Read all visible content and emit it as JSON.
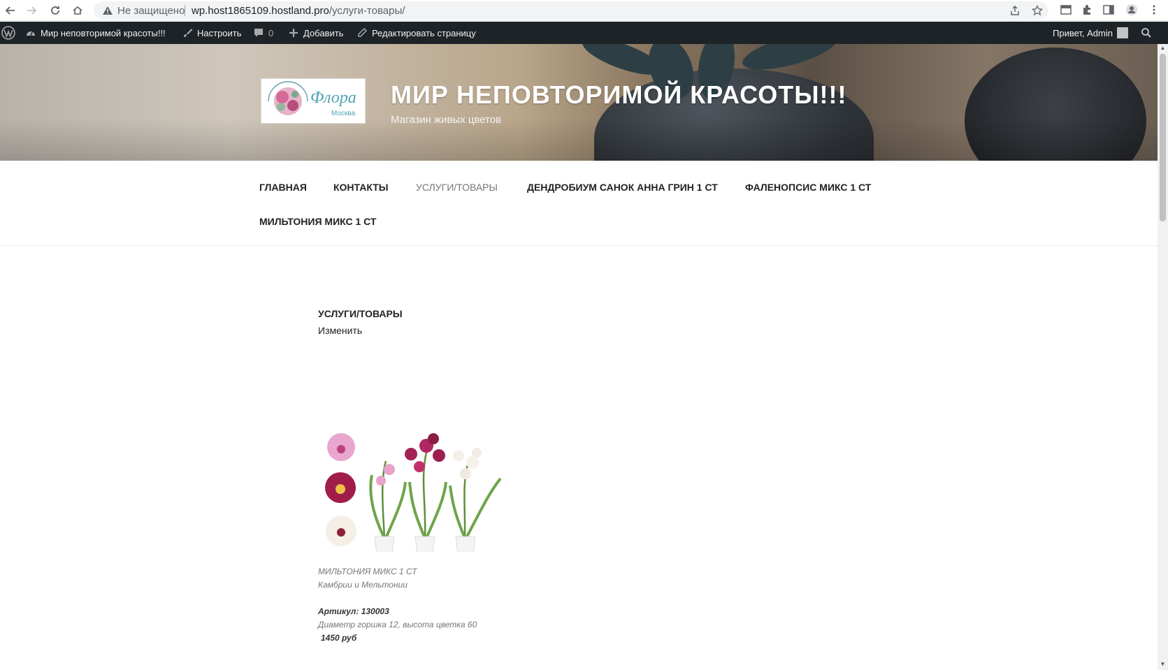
{
  "browser": {
    "security_text": "Не защищено",
    "url_host": "wp.host1865109.hostland.pro",
    "url_path": "/услуги-товары/"
  },
  "adminbar": {
    "site_name": "Мир неповторимой красоты!!!",
    "customize": "Настроить",
    "comments_count": "0",
    "add_new": "Добавить",
    "edit_page": "Редактировать страницу",
    "greeting": "Привет, Admin"
  },
  "header": {
    "title": "МИР НЕПОВТОРИМОЙ КРАСОТЫ!!!",
    "description": "Магазин живых цветов",
    "logo_text": "Флора",
    "logo_subtext": "Москва"
  },
  "nav": {
    "items": [
      {
        "label": "Главная"
      },
      {
        "label": "Контакты"
      },
      {
        "label": "Услуги/Товары"
      },
      {
        "label": "Дендробиум Санок Анна Грин 1 ст"
      },
      {
        "label": "Фаленопсис микс 1 ст"
      },
      {
        "label": "Мильтония микс 1 ст"
      }
    ]
  },
  "content": {
    "page_title": "УСЛУГИ/ТОВАРЫ",
    "edit_label": "Изменить",
    "product": {
      "name": "МИЛЬТОНИЯ МИКС 1 СТ",
      "subtitle": "Камбрии и Мельтонии",
      "sku": "Артикул: 130003",
      "specs": "Диаметр горшка 12, высота цветка 60",
      "price": "1450 руб"
    }
  }
}
